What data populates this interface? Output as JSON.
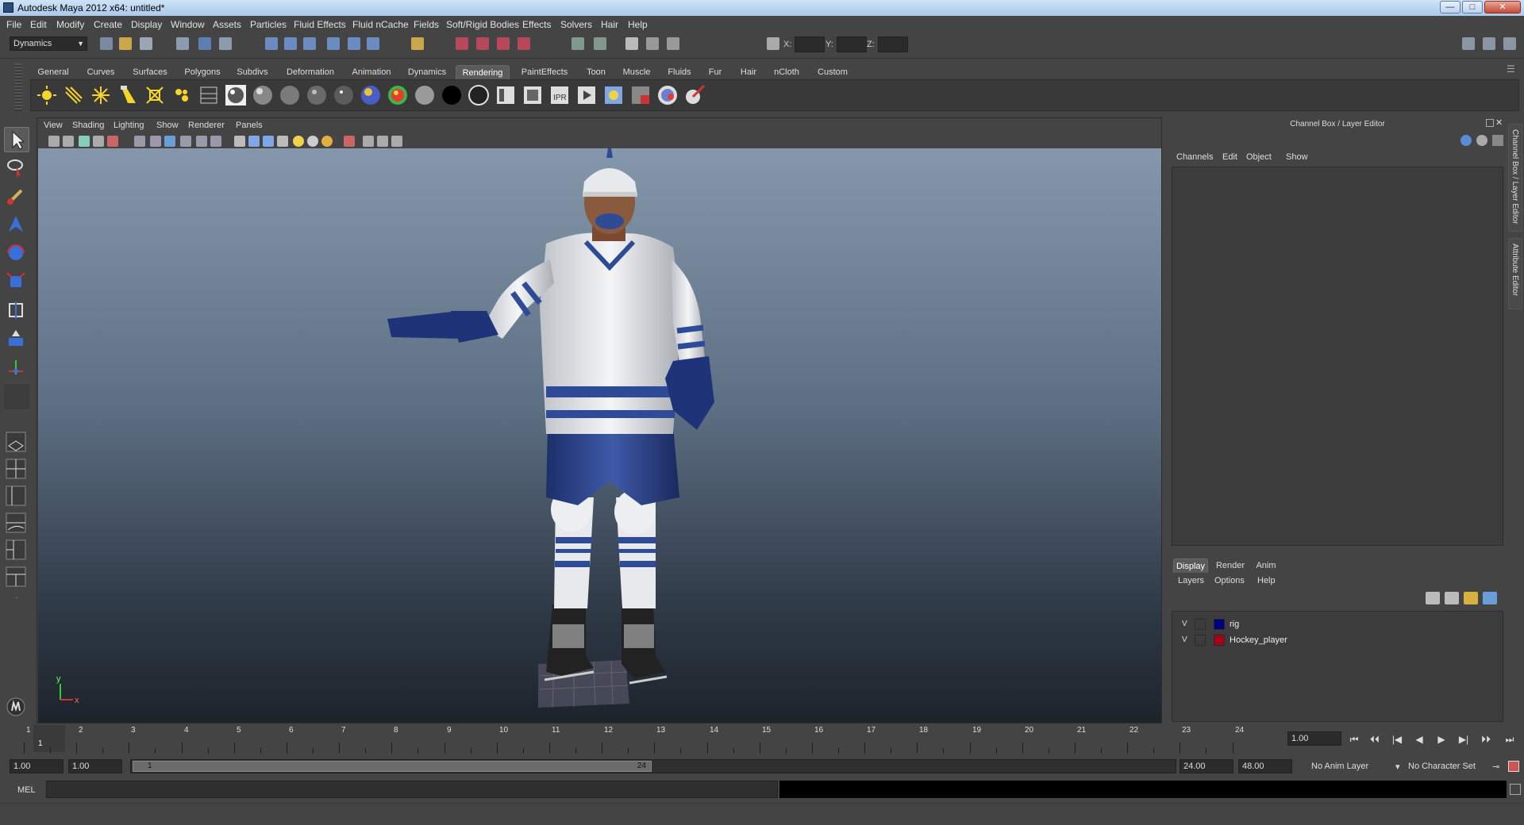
{
  "window": {
    "title": "Autodesk Maya 2012 x64: untitled*",
    "minimize_glyph": "—",
    "maximize_glyph": "□",
    "close_glyph": "✕"
  },
  "menubar": [
    "File",
    "Edit",
    "Modify",
    "Create",
    "Display",
    "Window",
    "Assets",
    "Particles",
    "Fluid Effects",
    "Fluid nCache",
    "Fields",
    "Soft/Rigid Bodies",
    "Effects",
    "Solvers",
    "Hair",
    "Help"
  ],
  "status_line": {
    "mode": "Dynamics",
    "coord_labels": [
      "X:",
      "Y:",
      "Z:"
    ]
  },
  "shelf": {
    "tabs": [
      "General",
      "Curves",
      "Surfaces",
      "Polygons",
      "Subdivs",
      "Deformation",
      "Animation",
      "Dynamics",
      "Rendering",
      "PaintEffects",
      "Toon",
      "Muscle",
      "Fluids",
      "Fur",
      "Hair",
      "nCloth",
      "Custom"
    ],
    "active_tab": "Rendering",
    "icons": [
      "ambient-light-icon",
      "directional-light-icon",
      "point-light-icon",
      "spot-light-icon",
      "area-light-icon",
      "volume-light-icon",
      "render-settings-icon",
      "phong-material-icon",
      "blinn-material-icon",
      "lambert-material-icon",
      "anisotropic-material-icon",
      "phong-e-material-icon",
      "ramp-shader-icon",
      "layered-shader-icon",
      "surface-shader-icon",
      "use-background-icon",
      "shadow-matte-icon",
      "render-view-icon",
      "render-current-icon",
      "ipr-render-icon",
      "batch-render-icon",
      "hypershade-icon",
      "render-layer-icon",
      "mental-ray-icon",
      "paint-canvas-icon"
    ]
  },
  "viewport": {
    "menus": [
      "View",
      "Shading",
      "Lighting",
      "Show",
      "Renderer",
      "Panels"
    ],
    "axis_y": "y",
    "axis_x": "x"
  },
  "channel_box": {
    "title": "Channel Box / Layer Editor",
    "menus": [
      "Channels",
      "Edit",
      "Object",
      "Show"
    ]
  },
  "layer_editor": {
    "tabs": [
      "Display",
      "Render",
      "Anim"
    ],
    "active_tab": "Display",
    "menus": [
      "Layers",
      "Options",
      "Help"
    ],
    "layers": [
      {
        "visible": "V",
        "name": "rig",
        "color": "#00007a"
      },
      {
        "visible": "V",
        "name": "Hockey_player",
        "color": "#a5001c"
      }
    ]
  },
  "side_tabs": [
    "Channel Box / Layer Editor",
    "Attribute Editor"
  ],
  "time_slider": {
    "ticks": [
      "1",
      "2",
      "3",
      "4",
      "5",
      "6",
      "7",
      "8",
      "9",
      "10",
      "11",
      "12",
      "13",
      "14",
      "15",
      "16",
      "17",
      "18",
      "19",
      "20",
      "21",
      "22",
      "23",
      "24"
    ],
    "current_marker": "1",
    "current_frame": "1.00"
  },
  "playback": [
    "⏮",
    "⏴⏴",
    "|◀",
    "◀",
    "▶",
    "▶|",
    "⏵⏵",
    "⏭"
  ],
  "range_slider": {
    "start_time": "1.00",
    "playback_start": "1.00",
    "range_start_label": "1",
    "range_end_label": "24",
    "playback_end": "24.00",
    "end_time": "48.00",
    "anim_layer": "No Anim Layer",
    "character_set": "No Character Set"
  },
  "command_line": {
    "label": "MEL"
  }
}
